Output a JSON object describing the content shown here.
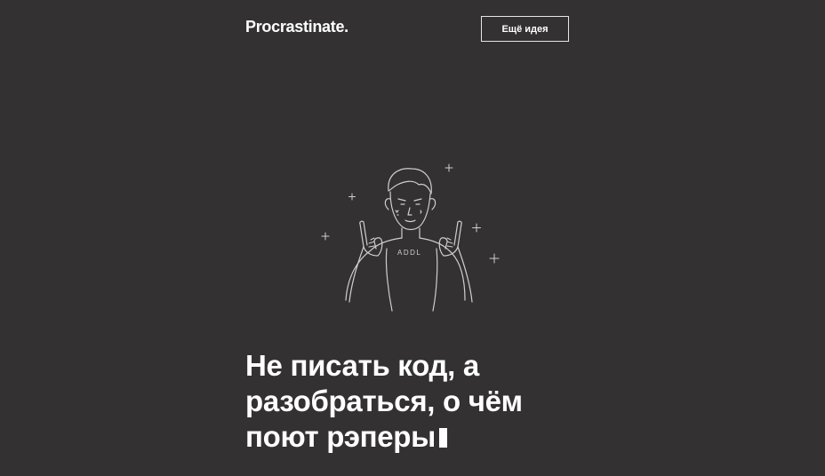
{
  "header": {
    "logo": "Procrastinate.",
    "idea_button": "Ещё идея"
  },
  "main": {
    "headline": "Не писать код, а разобраться, о чём поют рэперы",
    "illustration_label": "rapper-illustration",
    "shirt_text": "ADDL"
  },
  "colors": {
    "background": "#333132",
    "text": "#ffffff",
    "line_art": "#cfcfcf"
  }
}
